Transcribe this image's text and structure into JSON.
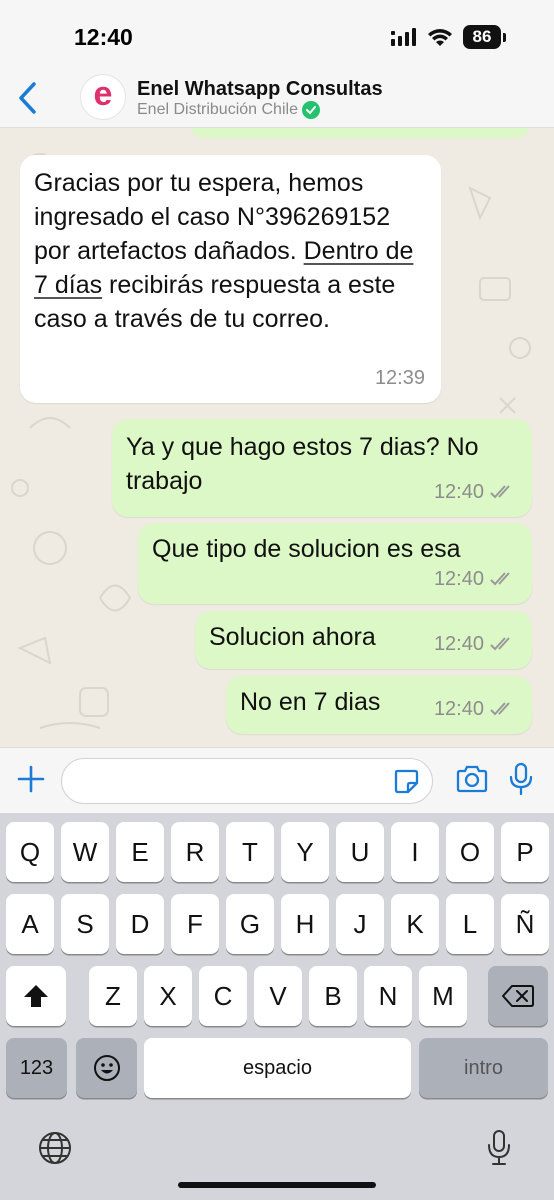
{
  "status_bar": {
    "time": "12:40",
    "battery": "86"
  },
  "header": {
    "title": "Enel Whatsapp Consultas",
    "subtitle": "Enel Distribución Chile",
    "avatar_letter": "e"
  },
  "messages": [
    {
      "direction": "incoming",
      "text_before": "Gracias por tu espera, hemos ingresado el caso N°396269152 por artefactos dañados. ",
      "link_text": "Dentro de 7 días",
      "text_after": " recibirás respuesta a este caso a través de tu correo.",
      "time": "12:39"
    },
    {
      "direction": "outgoing",
      "text": "Ya y que hago estos 7 dias? No trabajo",
      "time": "12:40"
    },
    {
      "direction": "outgoing",
      "text": "Que tipo de solucion es esa",
      "time": "12:40"
    },
    {
      "direction": "outgoing",
      "text": "Solucion ahora",
      "time": "12:40"
    },
    {
      "direction": "outgoing",
      "text": "No en 7 dias",
      "time": "12:40"
    }
  ],
  "input": {
    "value": "",
    "placeholder": ""
  },
  "keyboard": {
    "row1": [
      "Q",
      "W",
      "E",
      "R",
      "T",
      "Y",
      "U",
      "I",
      "O",
      "P"
    ],
    "row2": [
      "A",
      "S",
      "D",
      "F",
      "G",
      "H",
      "J",
      "K",
      "L",
      "Ñ"
    ],
    "row3": [
      "Z",
      "X",
      "C",
      "V",
      "B",
      "N",
      "M"
    ],
    "numbers_key": "123",
    "space_key": "espacio",
    "return_key": "intro"
  },
  "colors": {
    "incoming_bubble": "#ffffff",
    "outgoing_bubble": "#dcf8c6",
    "chat_background": "#efeae2",
    "accent_blue": "#1a7cd6",
    "avatar_brand": "#e0306c",
    "verified_green": "#25c26e"
  },
  "icons": [
    "back-chevron-icon",
    "verified-badge-icon",
    "read-receipt-icon",
    "plus-icon",
    "sticker-icon",
    "camera-icon",
    "microphone-icon",
    "shift-icon",
    "backspace-icon",
    "emoji-icon",
    "globe-icon",
    "dictation-icon",
    "signal-icon",
    "wifi-icon"
  ]
}
